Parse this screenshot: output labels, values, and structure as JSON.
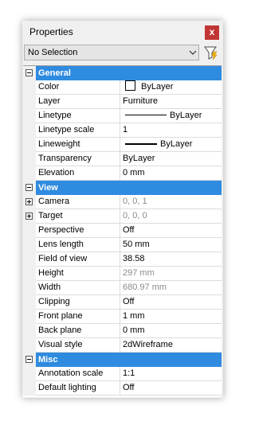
{
  "window": {
    "title": "Properties",
    "close_label": "x"
  },
  "selector": {
    "value": "No Selection"
  },
  "groups": [
    {
      "label": "General",
      "expanded": true,
      "rows": [
        {
          "name": "Color",
          "value": "ByLayer",
          "swatch": true
        },
        {
          "name": "Layer",
          "value": "Furniture"
        },
        {
          "name": "Linetype",
          "value": "ByLayer",
          "line": "linetype"
        },
        {
          "name": "Linetype scale",
          "value": "1"
        },
        {
          "name": "Lineweight",
          "value": "ByLayer",
          "line": "lineweight"
        },
        {
          "name": "Transparency",
          "value": "ByLayer"
        },
        {
          "name": "Elevation",
          "value": "0 mm"
        }
      ]
    },
    {
      "label": "View",
      "expanded": true,
      "rows": [
        {
          "name": "Camera",
          "value": "0, 0, 1",
          "dim": true,
          "expandable": true
        },
        {
          "name": "Target",
          "value": "0, 0, 0",
          "dim": true,
          "expandable": true
        },
        {
          "name": "Perspective",
          "value": "Off"
        },
        {
          "name": "Lens length",
          "value": "50 mm"
        },
        {
          "name": "Field of view",
          "value": "38.58"
        },
        {
          "name": "Height",
          "value": "297 mm",
          "dim": true
        },
        {
          "name": "Width",
          "value": "680.97 mm",
          "dim": true
        },
        {
          "name": "Clipping",
          "value": "Off"
        },
        {
          "name": "Front plane",
          "value": "1 mm"
        },
        {
          "name": "Back plane",
          "value": "0 mm"
        },
        {
          "name": "Visual style",
          "value": "2dWireframe"
        }
      ]
    },
    {
      "label": "Misc",
      "expanded": true,
      "rows": [
        {
          "name": "Annotation scale",
          "value": "1:1"
        },
        {
          "name": "Default lighting",
          "value": "Off"
        }
      ]
    }
  ],
  "colors": {
    "category_bar": "#2f8be0",
    "close_button": "#c13535"
  }
}
